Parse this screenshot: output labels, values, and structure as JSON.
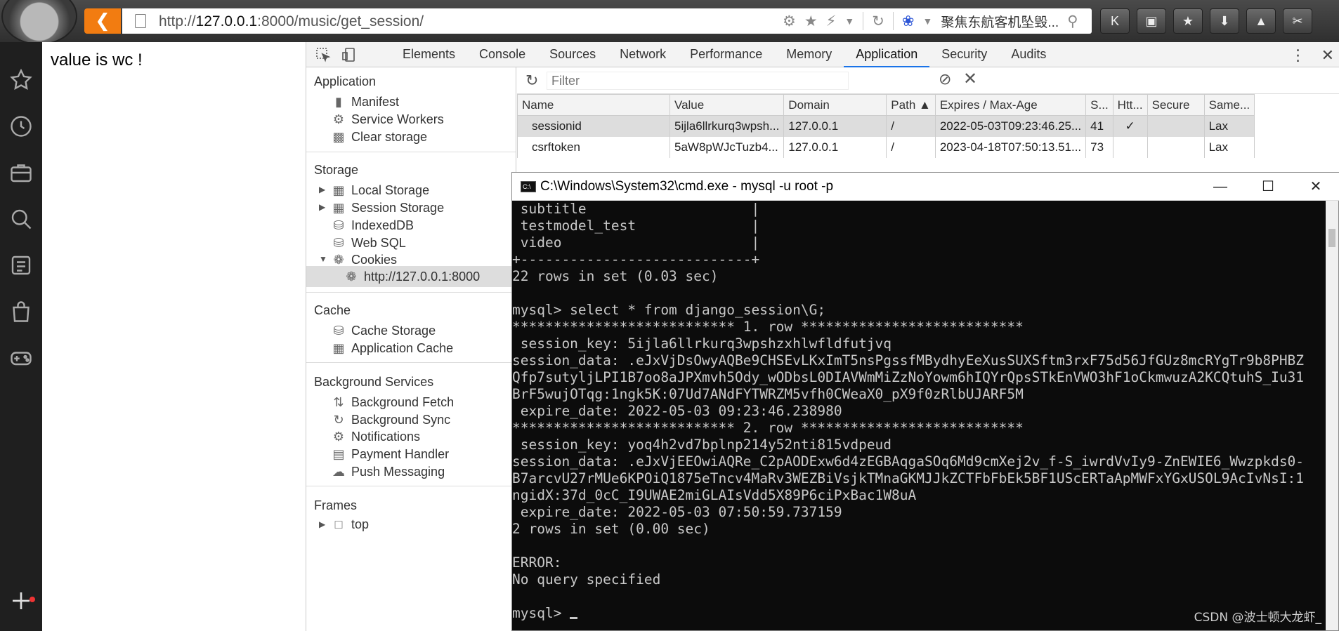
{
  "browser": {
    "url_prefix": "http://",
    "url_host": "127.0.0.1",
    "url_rest": ":8000/music/get_session/",
    "search_text": "聚焦东航客机坠毁...",
    "toolbar_buttons": [
      "K",
      "lock",
      "star",
      "download",
      "gamepad",
      "scissors"
    ]
  },
  "page": {
    "text": "value is wc !"
  },
  "devtools": {
    "tabs": [
      "Elements",
      "Console",
      "Sources",
      "Network",
      "Performance",
      "Memory",
      "Application",
      "Security",
      "Audits"
    ],
    "active_tab": "Application",
    "nav": {
      "application_head": "Application",
      "application_items": [
        "Manifest",
        "Service Workers",
        "Clear storage"
      ],
      "storage_head": "Storage",
      "storage_items": [
        "Local Storage",
        "Session Storage",
        "IndexedDB",
        "Web SQL",
        "Cookies"
      ],
      "cookie_site": "http://127.0.0.1:8000",
      "cache_head": "Cache",
      "cache_items": [
        "Cache Storage",
        "Application Cache"
      ],
      "bg_head": "Background Services",
      "bg_items": [
        "Background Fetch",
        "Background Sync",
        "Notifications",
        "Payment Handler",
        "Push Messaging"
      ],
      "frames_head": "Frames",
      "frames_item": "top"
    },
    "filter_placeholder": "Filter",
    "table": {
      "headers": [
        "Name",
        "Value",
        "Domain",
        "Path ▲",
        "Expires / Max-Age",
        "S...",
        "Htt...",
        "Secure",
        "Same..."
      ],
      "rows": [
        [
          "sessionid",
          "5ijla6llrkurq3wpsh...",
          "127.0.0.1",
          "/",
          "2022-05-03T09:23:46.25...",
          "41",
          "✓",
          "",
          "Lax"
        ],
        [
          "csrftoken",
          "5aW8pWJcTuzb4...",
          "127.0.0.1",
          "/",
          "2023-04-18T07:50:13.51...",
          "73",
          "",
          "",
          "Lax"
        ]
      ]
    }
  },
  "cmd": {
    "title": "C:\\Windows\\System32\\cmd.exe - mysql  -u root -p",
    "lines": [
      " subtitle                    |",
      " testmodel_test              |",
      " video                       |",
      "+----------------------------+",
      "22 rows in set (0.03 sec)",
      "",
      "mysql> select * from django_session\\G;",
      "*************************** 1. row ***************************",
      " session_key: 5ijla6llrkurq3wpshzxhlwfldfutjvq",
      "session_data: .eJxVjDsOwyAQBe9CHSEvLKxImT5nsPgssfMBydhyEeXusSUXSftm3rxF75d56JfGUz8mcRYgTr9b8PHBZ",
      "Qfp7sutyljLPI1B7oo8aJPXmvh5Ody_wODbsL0DIAVWmMiZzNoYowm6hIQYrQpsSTkEnVWO3hF1oCkmwuzA2KCQtuhS_Iu31",
      "BrF5wujOTqg:1ngk5K:07Ud7ANdFYTWRZM5vfh0CWeaX0_pX9f0zRlbUJARF5M",
      " expire_date: 2022-05-03 09:23:46.238980",
      "*************************** 2. row ***************************",
      " session_key: yoq4h2vd7bplnp214y52nti815vdpeud",
      "session_data: .eJxVjEEOwiAQRe_C2pAODExw6d4zEGBAqgaSOq6Md9cmXej2v_f-S_iwrdVvIy9-ZnEWIE6_Wwzpkds0-",
      "B7arcvU27rMUe6KPOiQ1875eTncv4MaRv3WEZBiVsjkTMnaGKMJJkZCTFbFbEk5BF1UScERTaApMWFxYGxUSOL9AcIvNsI:1",
      "ngidX:37d_0cC_I9UWAE2miGLAIsVdd5X89P6ciPxBac1W8uA",
      " expire_date: 2022-05-03 07:50:59.737159",
      "2 rows in set (0.00 sec)",
      "",
      "ERROR:",
      "No query specified",
      "",
      "mysql> "
    ],
    "watermark": "CSDN @波士顿大龙虾_"
  }
}
